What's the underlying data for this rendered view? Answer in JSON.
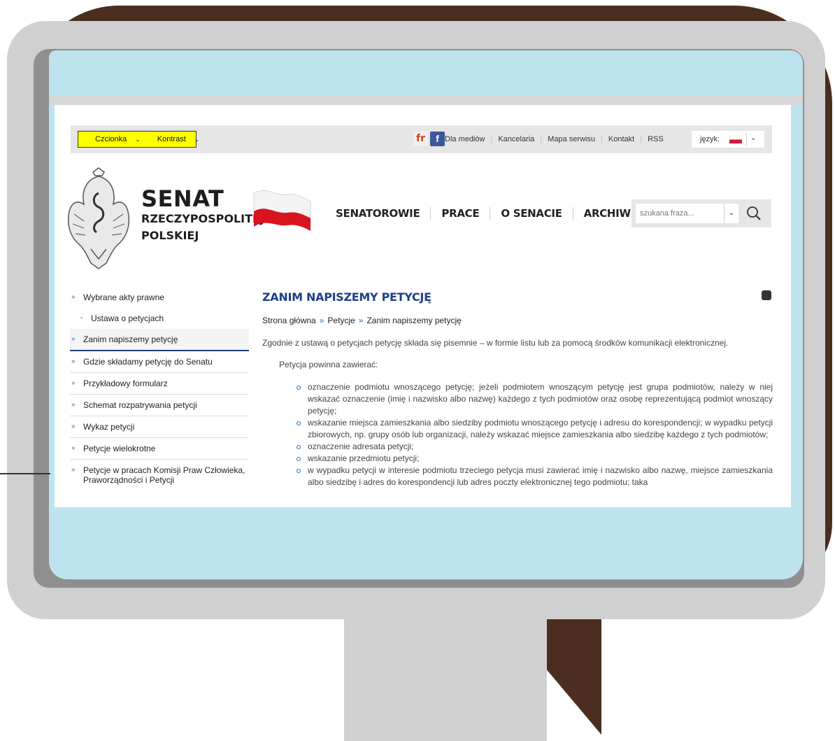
{
  "access_bar": {
    "font_label": "Czcionka",
    "contrast_label": "Kontrast"
  },
  "social": {
    "fr_label": "fr",
    "fb_label": "f"
  },
  "top_links": [
    "Dla mediów",
    "Kancelaria",
    "Mapa serwisu",
    "Kontakt",
    "RSS"
  ],
  "language": {
    "label": "język:"
  },
  "logo": {
    "title": "SENAT",
    "line2": "RZECZYPOSPOLITEJ",
    "line3": "POLSKIEJ"
  },
  "main_nav": [
    "SENATOROWIE",
    "PRACE",
    "O SENACIE",
    "ARCHIWUM"
  ],
  "search": {
    "placeholder": "szukana fraza..."
  },
  "sidebar": {
    "items": [
      {
        "label": "Wybrane akty prawne",
        "kind": "noline"
      },
      {
        "label": "Ustawa o petycjach",
        "kind": "sub"
      },
      {
        "label": "Zanim napiszemy petycję",
        "kind": "active"
      },
      {
        "label": "Gdzie składamy petycję do Senatu",
        "kind": "normal"
      },
      {
        "label": "Przykładowy formularz",
        "kind": "normal"
      },
      {
        "label": "Schemat rozpatrywania petycji",
        "kind": "normal"
      },
      {
        "label": "Wykaz petycji",
        "kind": "normal"
      },
      {
        "label": "Petycje wielokrotne",
        "kind": "normal"
      },
      {
        "label": "Petycje w pracach Komisji Praw Człowieka, Praworządności i Petycji",
        "kind": "noline"
      }
    ]
  },
  "content": {
    "title": "ZANIM NAPISZEMY PETYCJĘ",
    "breadcrumb": [
      "Strona główna",
      "Petycje",
      "Zanim napiszemy petycję"
    ],
    "intro": "Zgodnie z ustawą o petycjach petycję składa się pisemnie – w formie listu lub za pomocą środków komunikacji elektronicznej.",
    "must_contain": "Petycja powinna zawierać:",
    "bullets": [
      "oznaczenie podmiotu wnoszącego petycję; jeżeli podmiotem wnoszącym petycję jest grupa podmiotów, należy w niej wskazać oznaczenie (imię i nazwisko albo nazwę) każdego z tych podmiotów oraz osobę reprezentującą podmiot wnoszący petycję;",
      "wskazanie miejsca zamieszkania albo siedziby podmiotu wnoszącego petycję i adresu do korespondencji; w wypadku petycji zbiorowych, np.  grupy osób lub organizacji, należy wskazać miejsce zamieszkania albo siedzibę każdego z tych podmiotów;",
      "oznaczenie adresata petycji;",
      "wskazanie przedmiotu petycji;",
      "w wypadku petycji w interesie podmiotu trzeciego petycja musi zawierać imię i nazwisko albo nazwę, miejsce zamieszkania albo siedzibę i adres do korespondencji lub adres poczty elektronicznej tego podmiotu; taka"
    ]
  },
  "colors": {
    "brown": "#4b2e1f",
    "frame": "#d0d0d0",
    "screen": "#bde4ee",
    "highlight": "#ffff00",
    "title_blue": "#1f3e8a"
  }
}
